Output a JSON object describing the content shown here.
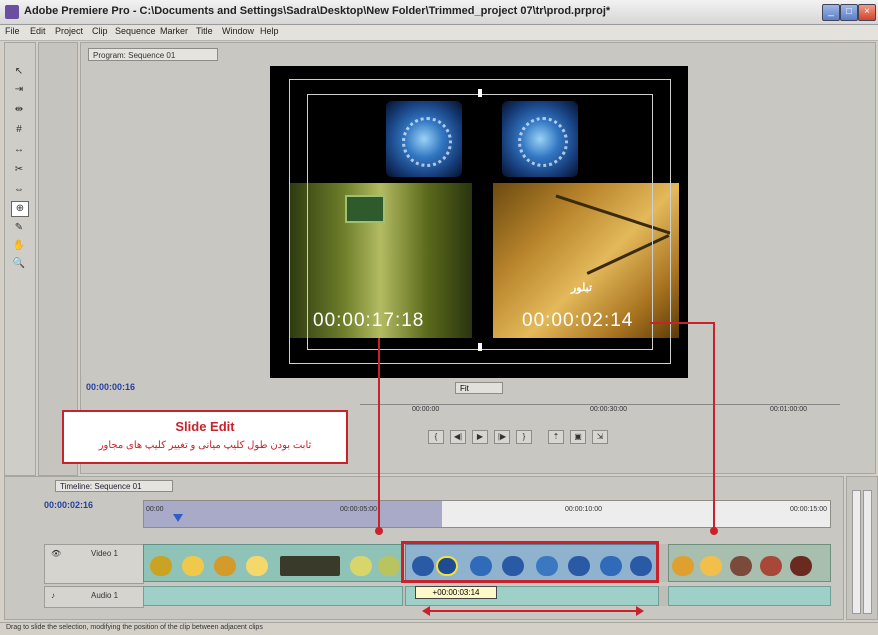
{
  "window": {
    "title": "Adobe Premiere Pro - C:\\Documents and Settings\\Sadra\\Desktop\\New Folder\\Trimmed_project 07\\tr\\prod.prproj*"
  },
  "menu": [
    "File",
    "Edit",
    "Project",
    "Clip",
    "Sequence",
    "Marker",
    "Title",
    "Window",
    "Help"
  ],
  "monitor": {
    "tab_label": "Program: Sequence 01",
    "timecode_left": "00:00:17:18",
    "timecode_right": "00:00:02:14",
    "current_time": "00:00:00:16",
    "zoom": "Fit",
    "ruler": [
      "00:00:00",
      "00:00:30:00",
      "00:01:00:00"
    ],
    "overlay_text": "تبلور"
  },
  "callout": {
    "heading": "Slide Edit",
    "body": "ثابت بودن طول کلیپ میانی و تغییر کلیپ های مجاور"
  },
  "timeline": {
    "tab_label": "Timeline: Sequence 01",
    "timecode": "00:00:02:16",
    "ruler": [
      "00:00",
      "00:00:05:00",
      "00:00:10:00",
      "00:00:15:00"
    ],
    "tracks": {
      "video": "Video 1",
      "audio": "Audio 1"
    },
    "clip_tooltip": "+00:00:03:14"
  },
  "status": "Drag to slide the selection, modifying the position of the clip between adjacent clips",
  "colors": {
    "accent_red": "#c8232c"
  }
}
